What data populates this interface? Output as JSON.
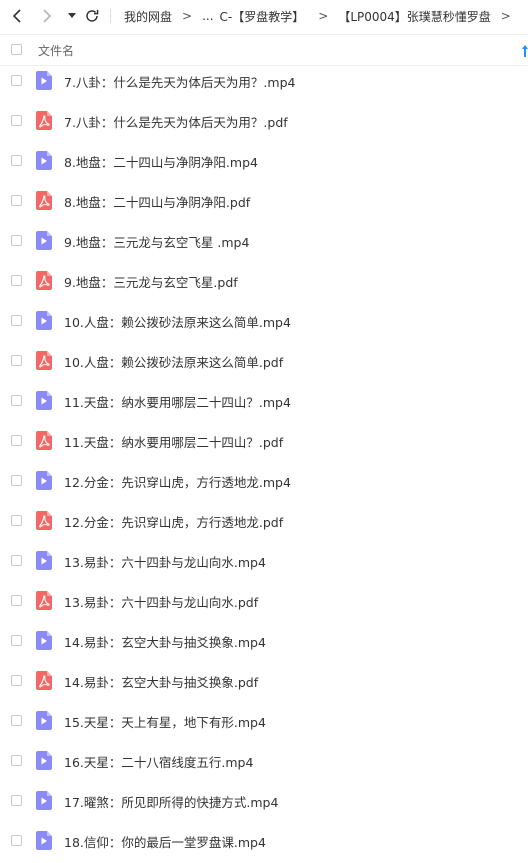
{
  "nav": {
    "back_icon": "chevron-left-icon",
    "forward_icon": "chevron-right-icon",
    "dropdown_icon": "caret-down-icon",
    "refresh_icon": "refresh-icon"
  },
  "breadcrumb": {
    "items": [
      "我的网盘",
      "...",
      "C-【罗盘教学】",
      "【LP0004】张璞慧秒懂罗盘"
    ],
    "separator": ">"
  },
  "header": {
    "column_label": "文件名",
    "sort_icon": "sort-arrow-icon"
  },
  "colors": {
    "video_icon": "#8b8bf5",
    "pdf_icon": "#f56767",
    "accent": "#1e90ff"
  },
  "files": [
    {
      "name": "7.八卦：什么是先天为体后天为用？.mp4",
      "type": "video"
    },
    {
      "name": "7.八卦：什么是先天为体后天为用？.pdf",
      "type": "pdf"
    },
    {
      "name": "8.地盘：二十四山与净阴净阳.mp4",
      "type": "video"
    },
    {
      "name": "8.地盘：二十四山与净阴净阳.pdf",
      "type": "pdf"
    },
    {
      "name": "9.地盘：三元龙与玄空飞星 .mp4",
      "type": "video"
    },
    {
      "name": "9.地盘：三元龙与玄空飞星.pdf",
      "type": "pdf"
    },
    {
      "name": "10.人盘：赖公拨砂法原来这么简单.mp4",
      "type": "video"
    },
    {
      "name": "10.人盘：赖公拨砂法原来这么简单.pdf",
      "type": "pdf"
    },
    {
      "name": "11.天盘：纳水要用哪层二十四山？.mp4",
      "type": "video"
    },
    {
      "name": "11.天盘：纳水要用哪层二十四山？.pdf",
      "type": "pdf"
    },
    {
      "name": "12.分金：先识穿山虎，方行透地龙.mp4",
      "type": "video"
    },
    {
      "name": "12.分金：先识穿山虎，方行透地龙.pdf",
      "type": "pdf"
    },
    {
      "name": "13.易卦：六十四卦与龙山向水.mp4",
      "type": "video"
    },
    {
      "name": "13.易卦：六十四卦与龙山向水.pdf",
      "type": "pdf"
    },
    {
      "name": "14.易卦：玄空大卦与抽爻换象.mp4",
      "type": "video"
    },
    {
      "name": "14.易卦：玄空大卦与抽爻换象.pdf",
      "type": "pdf"
    },
    {
      "name": "15.天星：天上有星，地下有形.mp4",
      "type": "video"
    },
    {
      "name": "16.天星：二十八宿线度五行.mp4",
      "type": "video"
    },
    {
      "name": "17.曜煞：所见即所得的快捷方式.mp4",
      "type": "video"
    },
    {
      "name": "18.信仰：你的最后一堂罗盘课.mp4",
      "type": "video"
    }
  ]
}
